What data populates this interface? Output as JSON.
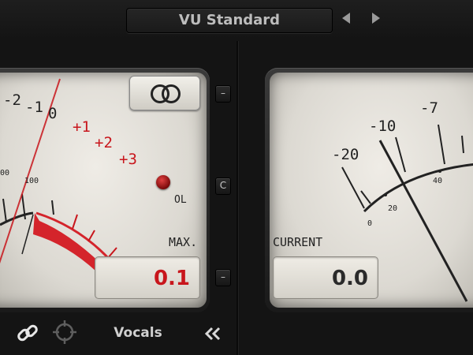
{
  "header": {
    "preset_name": "VU Standard",
    "prev_icon": "triangle-left-icon",
    "next_icon": "triangle-right-icon"
  },
  "left_meter": {
    "scale_labels": [
      "-2",
      "-1",
      "0",
      "+1",
      "+2",
      "+3"
    ],
    "percent_labels": [
      "00",
      "100"
    ],
    "ol_label": "OL",
    "caption": "MAX.",
    "readout": "0.1",
    "link_icon": "linked-rings-icon"
  },
  "right_meter": {
    "scale_labels": [
      "-20",
      "-10",
      "-7"
    ],
    "percent_labels": [
      "0",
      "20",
      "40"
    ],
    "caption": "CURRENT",
    "readout": "0.0"
  },
  "side_buttons": [
    "–",
    "C",
    "–"
  ],
  "footer": {
    "channel_name": "Vocals",
    "link_icon": "chain-link-icon",
    "target_icon": "crosshair-icon",
    "collapse_icon": "double-chevron-left-icon"
  },
  "colors": {
    "accent_red": "#c8161c",
    "panel_bg": "#141414",
    "meter_face": "#e6e3dc",
    "text_light": "#d0d0d0"
  }
}
